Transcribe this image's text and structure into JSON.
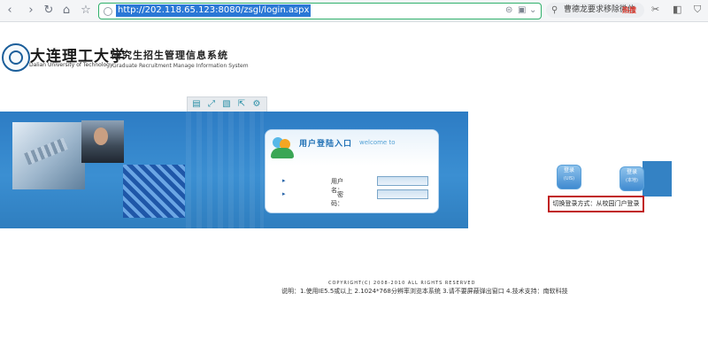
{
  "browser": {
    "url": "http://202.118.65.123:8080/zsgl/login.aspx",
    "search_text": "曹德龙要求移除微信",
    "search_hot": "热搜"
  },
  "brand": {
    "name_cn": "大连理工大学",
    "name_en": "Dalian University of Technology",
    "system_cn": "研究生招生管理信息系统",
    "system_en": "Graduate Recruitment Manage Information System"
  },
  "login": {
    "title": "用户登陆入口",
    "welcome": "welcome to",
    "username_label": "用户名：",
    "password_label": "密  码："
  },
  "switch": {
    "btn_unified": {
      "label": "登录",
      "sub": "(UIS)"
    },
    "btn_local": {
      "label": "登录",
      "sub": "(本地)"
    },
    "label": "切换登录方式：从校园门户登录"
  },
  "footer": {
    "copyright": "COPYRIGHT(C) 2008-2010 ALL RIGHTS RESERVED",
    "notes": "说明：1.使用IE5.5或以上 2.1024*768分辨率浏览本系统 3.请不要屏蔽弹出窗口 4.技术支持：南软科技"
  }
}
